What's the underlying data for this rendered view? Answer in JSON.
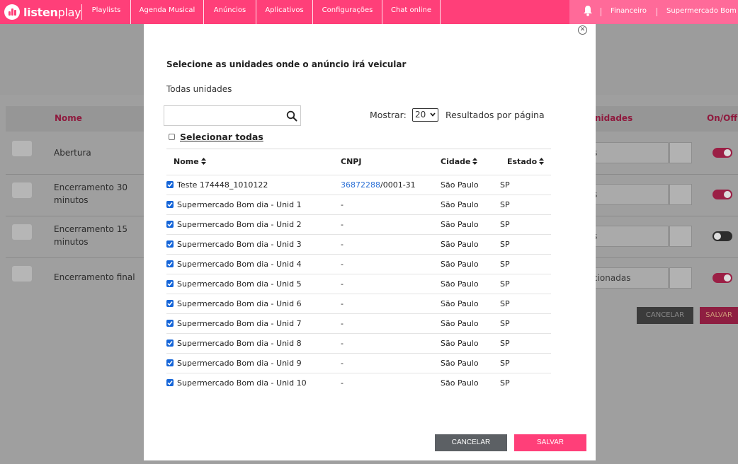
{
  "brand": {
    "name_bold": "listen",
    "name_light": "play"
  },
  "nav": {
    "items": [
      "Playlists",
      "Agenda Musical",
      "Anúncios",
      "Aplicativos",
      "Configurações",
      "Chat online"
    ],
    "right": {
      "finance": "Financeiro",
      "account": "Supermercado Bom di"
    }
  },
  "background": {
    "columns": {
      "name": "Nome",
      "units": "nidades",
      "onoff": "On/Off"
    },
    "rows": [
      {
        "name": "Abertura",
        "units_value": "s",
        "toggle": "on"
      },
      {
        "name": "Encerramento 30 minutos",
        "units_value": "s",
        "toggle": "on"
      },
      {
        "name": "Encerramento 15 minutos",
        "units_value": "s",
        "toggle": "off"
      },
      {
        "name": "Encerramento final",
        "units_value": "cionadas",
        "toggle": "on"
      }
    ],
    "cancel_label": "CANCELAR",
    "save_label": "SALVAR"
  },
  "modal": {
    "title": "Selecione as unidades onde o anúncio irá veicular",
    "subtitle": "Todas unidades",
    "search": {
      "value": "",
      "placeholder": ""
    },
    "show_label": "Mostrar:",
    "per_page": "20",
    "results_label": "Resultados por página",
    "select_all_label": "Selecionar todas",
    "headers": {
      "name": "Nome",
      "cnpj": "CNPJ",
      "city": "Cidade",
      "state": "Estado"
    },
    "rows": [
      {
        "name": "Teste 174448_1010122",
        "cnpj_link": "36872288",
        "cnpj_rest": "/0001-31",
        "city": "São Paulo",
        "state": "SP"
      },
      {
        "name": "Supermercado Bom dia - Unid 1",
        "cnpj_link": "",
        "cnpj_rest": "-",
        "city": "São Paulo",
        "state": "SP"
      },
      {
        "name": "Supermercado Bom dia - Unid 2",
        "cnpj_link": "",
        "cnpj_rest": "-",
        "city": "São Paulo",
        "state": "SP"
      },
      {
        "name": "Supermercado Bom dia - Unid 3",
        "cnpj_link": "",
        "cnpj_rest": "-",
        "city": "São Paulo",
        "state": "SP"
      },
      {
        "name": "Supermercado Bom dia - Unid 4",
        "cnpj_link": "",
        "cnpj_rest": "-",
        "city": "São Paulo",
        "state": "SP"
      },
      {
        "name": "Supermercado Bom dia - Unid 5",
        "cnpj_link": "",
        "cnpj_rest": "-",
        "city": "São Paulo",
        "state": "SP"
      },
      {
        "name": "Supermercado Bom dia - Unid 6",
        "cnpj_link": "",
        "cnpj_rest": "-",
        "city": "São Paulo",
        "state": "SP"
      },
      {
        "name": "Supermercado Bom dia - Unid 7",
        "cnpj_link": "",
        "cnpj_rest": "-",
        "city": "São Paulo",
        "state": "SP"
      },
      {
        "name": "Supermercado Bom dia - Unid 8",
        "cnpj_link": "",
        "cnpj_rest": "-",
        "city": "São Paulo",
        "state": "SP"
      },
      {
        "name": "Supermercado Bom dia - Unid 9",
        "cnpj_link": "",
        "cnpj_rest": "-",
        "city": "São Paulo",
        "state": "SP"
      },
      {
        "name": "Supermercado Bom dia - Unid 10",
        "cnpj_link": "",
        "cnpj_rest": "-",
        "city": "São Paulo",
        "state": "SP"
      }
    ],
    "cancel_label": "CANCELAR",
    "save_label": "SALVAR"
  },
  "colors": {
    "brand": "#ff3f79",
    "brand_light": "#ff6a99",
    "checkbox": "#1565d8",
    "link": "#2a6fd6",
    "cancel": "#5c6064"
  }
}
